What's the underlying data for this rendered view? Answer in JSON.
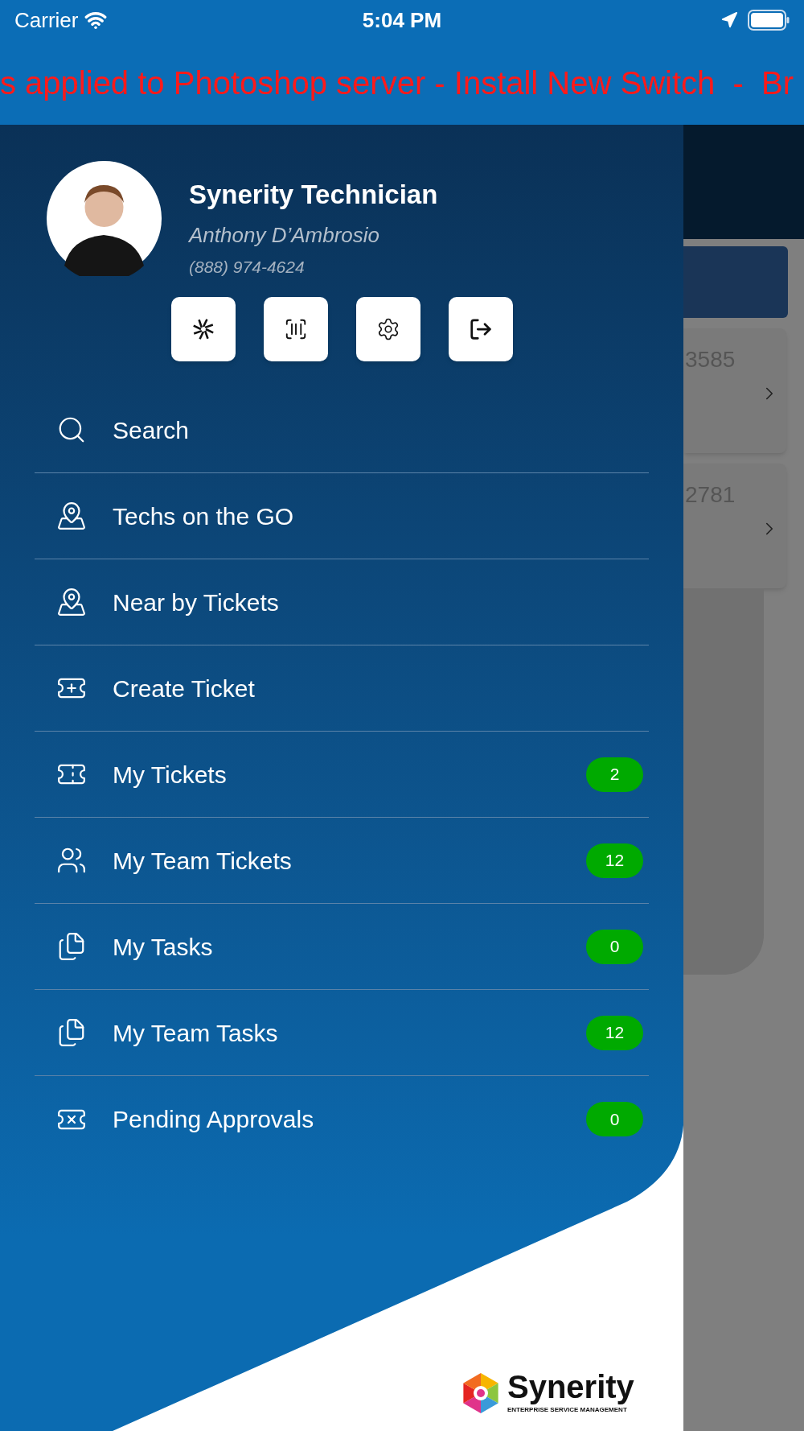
{
  "status_bar": {
    "carrier": "Carrier",
    "time": "5:04 PM"
  },
  "ticker": "s applied to Photoshop server - Install New Switch  -  Br",
  "profile": {
    "role": "Synerity Technician",
    "name": "Anthony D’Ambrosio",
    "phone": "(888) 974-4624"
  },
  "quick_actions": [
    {
      "kind": "starburst"
    },
    {
      "kind": "barcode"
    },
    {
      "kind": "settings"
    },
    {
      "kind": "logout"
    }
  ],
  "menu": [
    {
      "label": "Search",
      "kind": "search"
    },
    {
      "label": "Techs on the GO",
      "kind": "map"
    },
    {
      "label": "Near by Tickets",
      "kind": "map"
    },
    {
      "label": "Create Ticket",
      "kind": "create"
    },
    {
      "label": "My Tickets",
      "kind": "ticket",
      "badge": "2"
    },
    {
      "label": "My Team Tickets",
      "kind": "team",
      "badge": "12"
    },
    {
      "label": "My Tasks",
      "kind": "tasks",
      "badge": "0"
    },
    {
      "label": "My Team Tasks",
      "kind": "tasks",
      "badge": "12"
    },
    {
      "label": "Pending Approvals",
      "kind": "approval",
      "badge": "0"
    }
  ],
  "background_cards": [
    {
      "number": "3585"
    },
    {
      "number": "2781"
    }
  ],
  "logo": {
    "name": "Synerity",
    "tagline": "ENTERPRISE SERVICE MANAGEMENT"
  }
}
